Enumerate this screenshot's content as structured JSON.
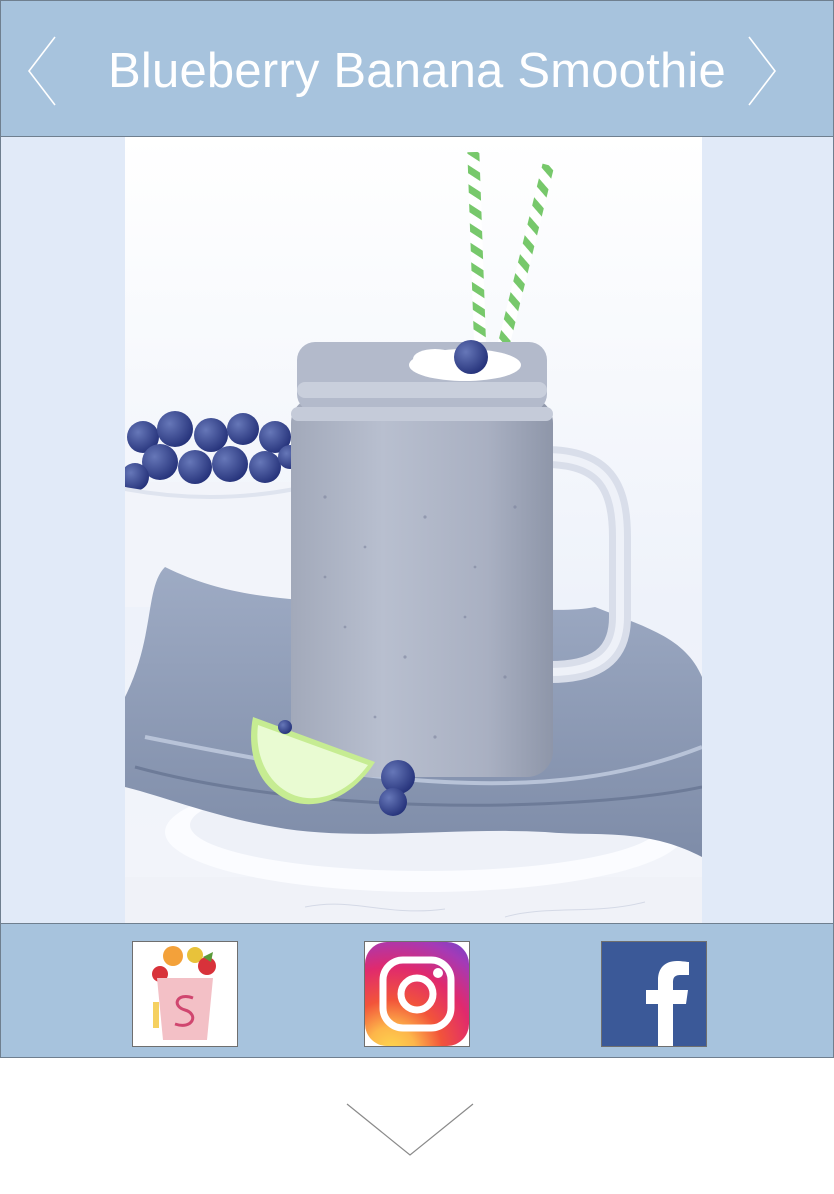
{
  "header": {
    "title": "Blueberry Banana Smoothie",
    "prev_icon": "chevron-left-icon",
    "next_icon": "chevron-right-icon"
  },
  "main": {
    "photo": "blueberry-banana-smoothie-photo"
  },
  "footer": {
    "links": [
      {
        "name": "smoothie-app-link",
        "icon": "smoothie-app-icon"
      },
      {
        "name": "instagram-link",
        "icon": "instagram-icon"
      },
      {
        "name": "facebook-link",
        "icon": "facebook-icon"
      }
    ]
  },
  "scroll": {
    "icon": "chevron-down-icon"
  },
  "colors": {
    "bar": "#a7c3dd",
    "panel": "#e1eaf8",
    "facebook": "#3b5998",
    "straw": "#76c96a"
  }
}
